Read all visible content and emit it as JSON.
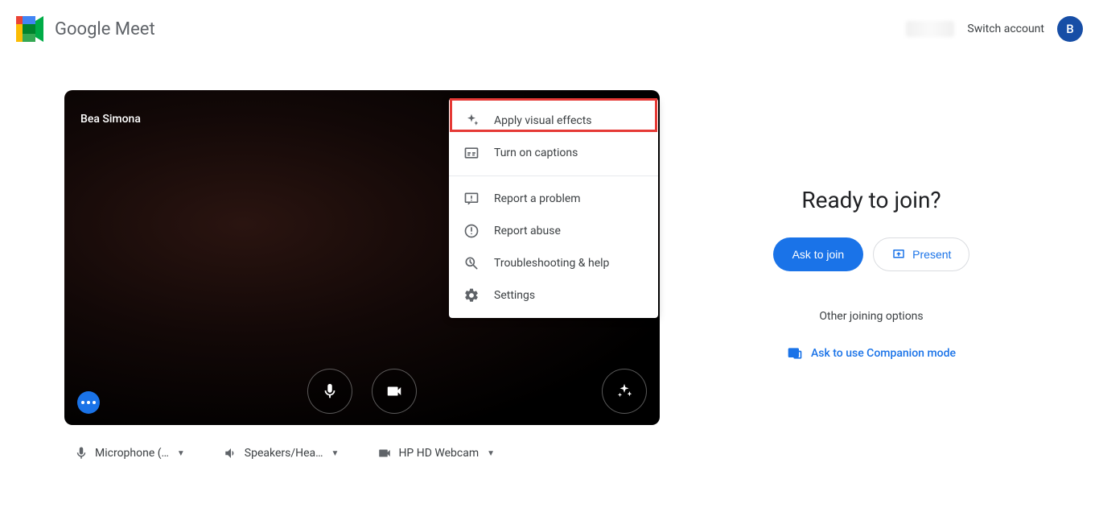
{
  "header": {
    "product_name": "Google Meet",
    "switch_account": "Switch account",
    "avatar_initial": "B"
  },
  "preview": {
    "participant_name": "Bea Simona"
  },
  "menu": {
    "apply_effects": "Apply visual effects",
    "captions": "Turn on captions",
    "report_problem": "Report a problem",
    "report_abuse": "Report abuse",
    "troubleshoot": "Troubleshooting & help",
    "settings": "Settings"
  },
  "devices": {
    "mic": "Microphone (…",
    "speaker": "Speakers/Hea…",
    "camera": "HP HD Webcam"
  },
  "join": {
    "title": "Ready to join?",
    "ask": "Ask to join",
    "present": "Present",
    "other_label": "Other joining options",
    "companion": "Ask to use Companion mode"
  }
}
